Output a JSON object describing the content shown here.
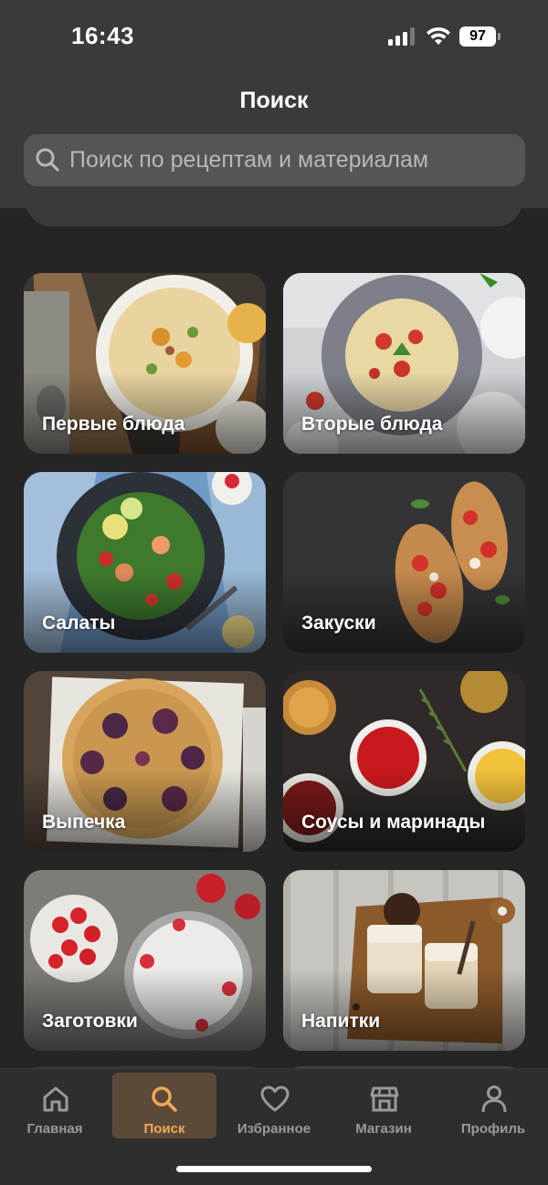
{
  "status_bar": {
    "time": "16:43",
    "battery": "97"
  },
  "header": {
    "title": "Поиск"
  },
  "search": {
    "placeholder": "Поиск по рецептам и материалам"
  },
  "categories": [
    {
      "label": "Первые блюда",
      "image": "soup-photo"
    },
    {
      "label": "Вторые блюда",
      "image": "pasta-photo"
    },
    {
      "label": "Салаты",
      "image": "salad-photo"
    },
    {
      "label": "Закуски",
      "image": "bruschetta-photo"
    },
    {
      "label": "Выпечка",
      "image": "berry-pie-photo"
    },
    {
      "label": "Соусы и маринады",
      "image": "sauces-photo"
    },
    {
      "label": "Заготовки",
      "image": "strawberry-jam-photo"
    },
    {
      "label": "Напитки",
      "image": "iced-coffee-photo"
    }
  ],
  "tabbar": {
    "items": [
      {
        "label": "Главная",
        "icon": "home-icon"
      },
      {
        "label": "Поиск",
        "icon": "search-icon",
        "active": true
      },
      {
        "label": "Избранное",
        "icon": "heart-icon"
      },
      {
        "label": "Магазин",
        "icon": "store-icon"
      },
      {
        "label": "Профиль",
        "icon": "profile-icon"
      }
    ]
  },
  "colors": {
    "background": "#252525",
    "header": "#3a3a3a",
    "search_field": "#555555",
    "accent": "#f0a954",
    "active_tab_bg": "#5c4a39",
    "inactive_tab": "#9a9a9a"
  }
}
